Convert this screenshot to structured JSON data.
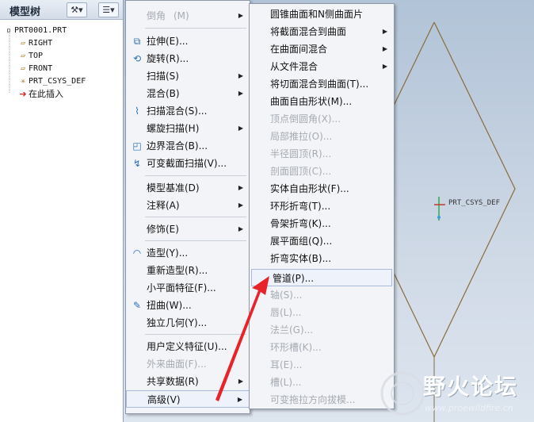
{
  "tree": {
    "title": "模型树",
    "nodes": [
      {
        "label": "PRT0001.PRT",
        "icon": "part-icon"
      },
      {
        "label": "RIGHT",
        "icon": "datum-plane-icon"
      },
      {
        "label": "TOP",
        "icon": "datum-plane-icon"
      },
      {
        "label": "FRONT",
        "icon": "datum-plane-icon"
      },
      {
        "label": "PRT_CSYS_DEF",
        "icon": "csys-icon"
      },
      {
        "label": "在此插入",
        "icon": "insert-arrow-icon"
      }
    ]
  },
  "menu1": {
    "items": [
      {
        "label": "倒角",
        "key": "(M)",
        "disabled": true
      },
      {
        "label": "拉伸(E)...",
        "disabled": false
      },
      {
        "label": "旋转(R)...",
        "disabled": false
      },
      {
        "label": "扫描(S)",
        "disabled": false
      },
      {
        "label": "混合(B)",
        "disabled": false
      },
      {
        "label": "扫描混合(S)...",
        "disabled": false
      },
      {
        "label": "螺旋扫描(H)",
        "disabled": false
      },
      {
        "label": "边界混合(B)...",
        "disabled": false
      },
      {
        "label": "可变截面扫描(V)...",
        "disabled": false
      },
      {
        "label": "模型基准(D)",
        "disabled": false
      },
      {
        "label": "注释(A)",
        "disabled": false
      },
      {
        "label": "修饰(E)",
        "disabled": false
      },
      {
        "label": "造型(Y)...",
        "disabled": false
      },
      {
        "label": "重新造型(R)...",
        "disabled": false
      },
      {
        "label": "小平面特征(F)...",
        "disabled": false
      },
      {
        "label": "扭曲(W)...",
        "disabled": false
      },
      {
        "label": "独立几何(Y)...",
        "disabled": false
      },
      {
        "label": "用户定义特征(U)...",
        "disabled": false
      },
      {
        "label": "外来曲面(F)...",
        "disabled": true
      },
      {
        "label": "共享数据(R)",
        "disabled": false
      },
      {
        "label": "高级(V)",
        "disabled": false
      }
    ]
  },
  "menu2": {
    "items": [
      {
        "label": "圆锥曲面和N侧曲面片",
        "disabled": false
      },
      {
        "label": "将截面混合到曲面",
        "disabled": false
      },
      {
        "label": "在曲面间混合",
        "disabled": false
      },
      {
        "label": "从文件混合",
        "disabled": false
      },
      {
        "label": "将切面混合到曲面(T)...",
        "disabled": false
      },
      {
        "label": "曲面自由形状(M)...",
        "disabled": false
      },
      {
        "label": "顶点倒圆角(X)...",
        "disabled": true
      },
      {
        "label": "局部推拉(O)...",
        "disabled": true
      },
      {
        "label": "半径圆顶(R)...",
        "disabled": true
      },
      {
        "label": "剖面圆顶(C)...",
        "disabled": true
      },
      {
        "label": "实体自由形状(F)...",
        "disabled": false
      },
      {
        "label": "环形折弯(T)...",
        "disabled": false
      },
      {
        "label": "骨架折弯(K)...",
        "disabled": false
      },
      {
        "label": "展平面组(Q)...",
        "disabled": false
      },
      {
        "label": "折弯实体(B)...",
        "disabled": false
      },
      {
        "label": "管道(P)...",
        "disabled": false
      },
      {
        "label": "轴(S)...",
        "disabled": true
      },
      {
        "label": "唇(L)...",
        "disabled": true
      },
      {
        "label": "法兰(G)...",
        "disabled": true
      },
      {
        "label": "环形槽(K)...",
        "disabled": true
      },
      {
        "label": "耳(E)...",
        "disabled": true
      },
      {
        "label": "槽(L)...",
        "disabled": true
      },
      {
        "label": "可变拖拉方向拔模...",
        "disabled": true
      }
    ]
  },
  "csys_label": "PRT_CSYS_DEF",
  "watermark": {
    "title": "野火论坛",
    "url": "www.proewildfire.cn"
  },
  "colors": {
    "accent_arrow": "#e8242a",
    "highlight_border": "#a9b9dc",
    "model_lines": "#8a6b3c"
  }
}
